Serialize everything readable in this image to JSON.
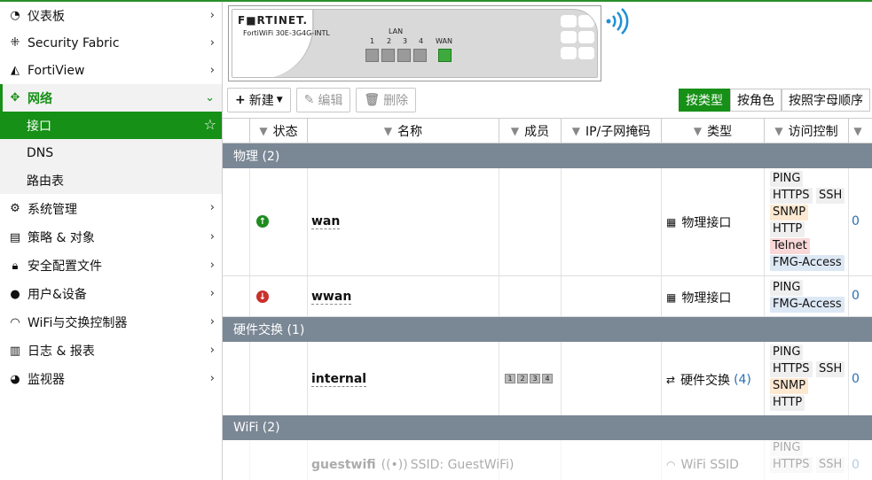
{
  "sidebar": {
    "items": [
      {
        "label": "仪表板",
        "icon": "dashboard-icon"
      },
      {
        "label": "Security Fabric",
        "icon": "fabric-icon"
      },
      {
        "label": "FortiView",
        "icon": "chart-icon"
      },
      {
        "label": "网络",
        "icon": "network-icon"
      },
      {
        "label": "系统管理",
        "icon": "gear-icon"
      },
      {
        "label": "策略 & 对象",
        "icon": "policy-icon"
      },
      {
        "label": "安全配置文件",
        "icon": "lock-icon"
      },
      {
        "label": "用户&设备",
        "icon": "user-icon"
      },
      {
        "label": "WiFi与交换控制器",
        "icon": "wifi-icon"
      },
      {
        "label": "日志 & 报表",
        "icon": "bar-chart-icon"
      },
      {
        "label": "监视器",
        "icon": "pie-chart-icon"
      }
    ],
    "subitems": [
      {
        "label": "接口"
      },
      {
        "label": "DNS"
      },
      {
        "label": "路由表"
      }
    ]
  },
  "device": {
    "brand": "F■RTINET.",
    "model": "FortiWiFi 30E-3G4G-INTL",
    "lan_label": "LAN",
    "ports": [
      "1",
      "2",
      "3",
      "4"
    ],
    "wan_label": "WAN"
  },
  "toolbar": {
    "new_label": "新建",
    "edit_label": "编辑",
    "delete_label": "删除"
  },
  "view_tabs": [
    "按类型",
    "按角色",
    "按照字母顺序"
  ],
  "columns": [
    "状态",
    "名称",
    "成员",
    "IP/子网掩码",
    "类型",
    "访问控制"
  ],
  "groups": {
    "physical": "物理 (2)",
    "hwswitch": "硬件交换 (1)",
    "wifi": "WiFi (2)"
  },
  "rows": {
    "wan": {
      "name": "wan",
      "type": "物理接口",
      "access": [
        "PING",
        "HTTPS",
        "SSH",
        "SNMP",
        "HTTP",
        "Telnet",
        "FMG-Access"
      ],
      "refs": "0"
    },
    "wwan": {
      "name": "wwan",
      "type": "物理接口",
      "access": [
        "PING",
        "FMG-Access"
      ],
      "refs": "0"
    },
    "internal": {
      "name": "internal",
      "type": "硬件交换",
      "type_count": "(4)",
      "members": [
        "1",
        "2",
        "3",
        "4"
      ],
      "access": [
        "PING",
        "HTTPS",
        "SSH",
        "SNMP",
        "HTTP"
      ],
      "refs": "0"
    },
    "guestwifi": {
      "name": "guestwifi",
      "ssid": "SSID: GuestWiFi)",
      "type": "WiFi SSID",
      "access": [
        "PING",
        "HTTPS",
        "SSH"
      ],
      "refs": "0"
    }
  }
}
